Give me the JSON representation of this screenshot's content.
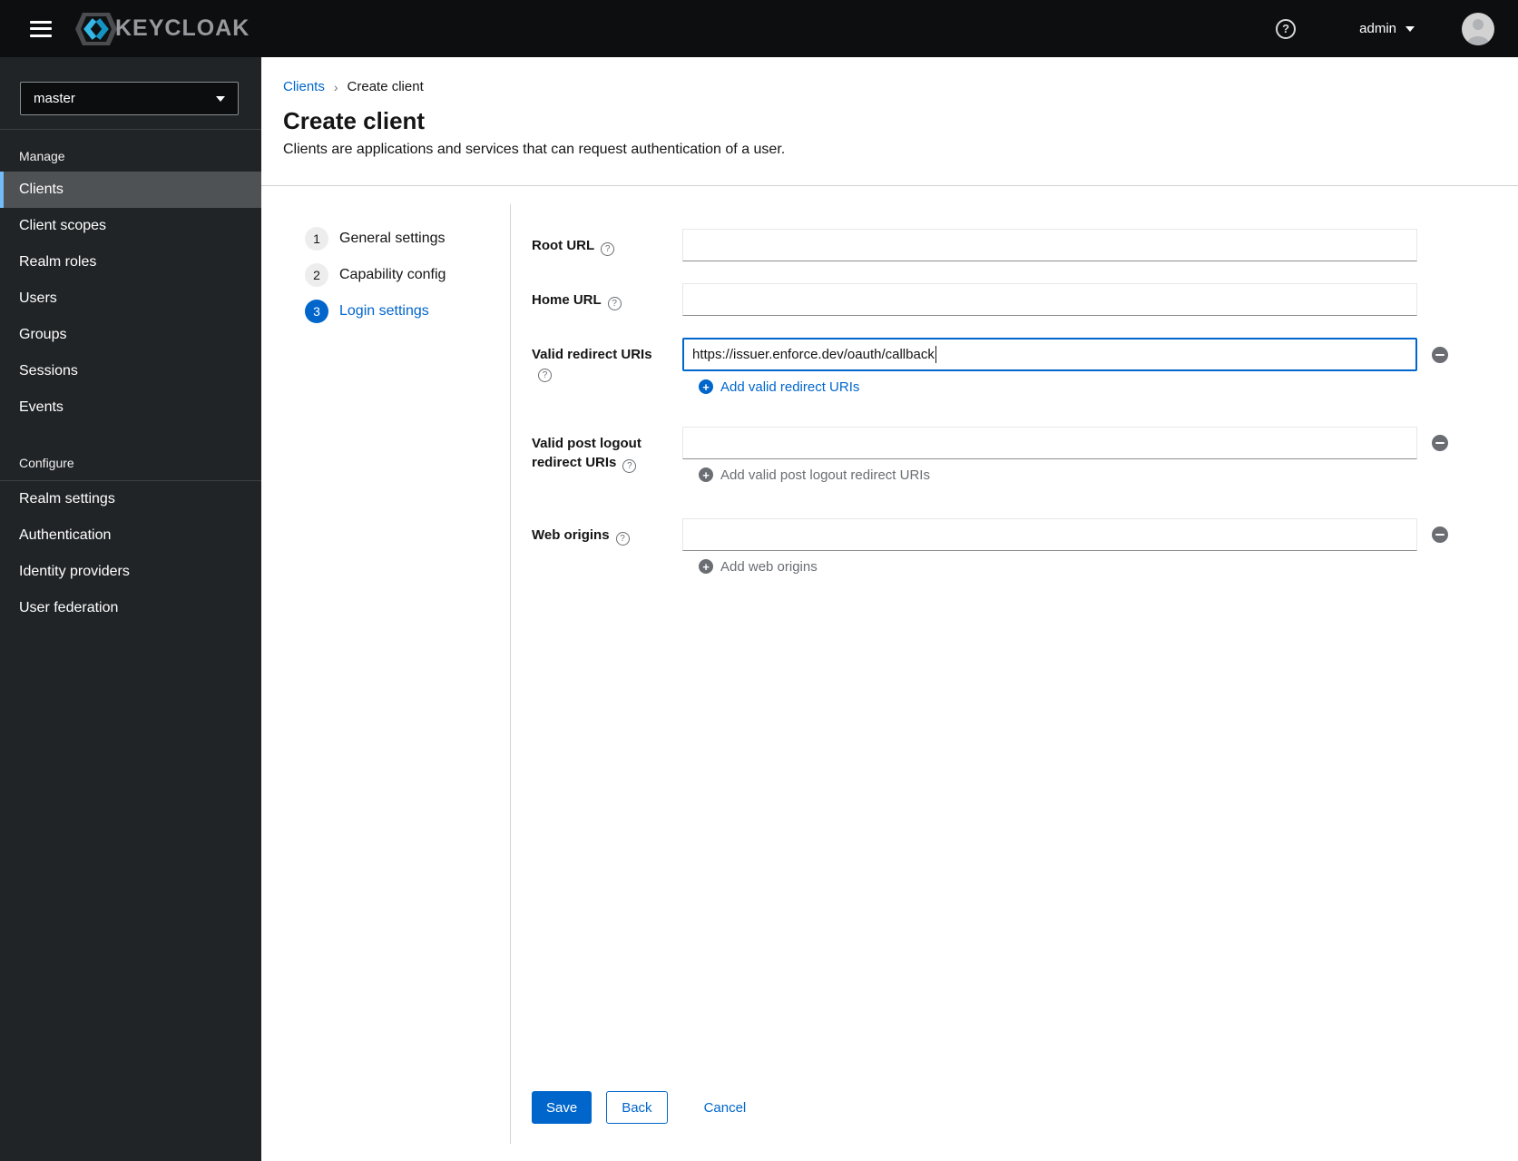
{
  "header": {
    "brand": "KEYCLOAK",
    "username": "admin"
  },
  "sidebar": {
    "realm_selector": {
      "value": "master"
    },
    "sections": [
      {
        "title": "Manage",
        "items": [
          {
            "label": "Clients",
            "selected": true
          },
          {
            "label": "Client scopes",
            "selected": false
          },
          {
            "label": "Realm roles",
            "selected": false
          },
          {
            "label": "Users",
            "selected": false
          },
          {
            "label": "Groups",
            "selected": false
          },
          {
            "label": "Sessions",
            "selected": false
          },
          {
            "label": "Events",
            "selected": false
          }
        ]
      },
      {
        "title": "Configure",
        "items": [
          {
            "label": "Realm settings",
            "selected": false
          },
          {
            "label": "Authentication",
            "selected": false
          },
          {
            "label": "Identity providers",
            "selected": false
          },
          {
            "label": "User federation",
            "selected": false
          }
        ]
      }
    ]
  },
  "breadcrumb": {
    "parent": "Clients",
    "current": "Create client"
  },
  "page": {
    "title": "Create client",
    "subtitle": "Clients are applications and services that can request authentication of a user."
  },
  "wizard": {
    "steps": [
      {
        "number": "1",
        "label": "General settings",
        "active": false
      },
      {
        "number": "2",
        "label": "Capability config",
        "active": false
      },
      {
        "number": "3",
        "label": "Login settings",
        "active": true
      }
    ]
  },
  "form": {
    "root_url": {
      "label": "Root URL",
      "value": ""
    },
    "home_url": {
      "label": "Home URL",
      "value": ""
    },
    "valid_redirect_uris": {
      "label": "Valid redirect URIs",
      "value": "https://issuer.enforce.dev/oauth/callback",
      "add_label": "Add valid redirect URIs",
      "add_enabled": true,
      "focused": true
    },
    "valid_post_logout_redirect_uris": {
      "label": "Valid post logout redirect URIs",
      "value": "",
      "add_label": "Add valid post logout redirect URIs",
      "add_enabled": false
    },
    "web_origins": {
      "label": "Web origins",
      "value": "",
      "add_label": "Add web origins",
      "add_enabled": false
    }
  },
  "actions": {
    "save": "Save",
    "back": "Back",
    "cancel": "Cancel"
  },
  "icons": {
    "help": "?",
    "add": "+"
  },
  "colors": {
    "primary": "#0066cc",
    "masthead_bg": "#0d0e10",
    "sidebar_bg": "#212427",
    "nav_selected_bg": "#4f5255",
    "nav_accent": "#73bcf7",
    "muted_gray": "#6a6e73",
    "divider": "#d2d2d2",
    "logo_cyan": "#33b8e8"
  }
}
